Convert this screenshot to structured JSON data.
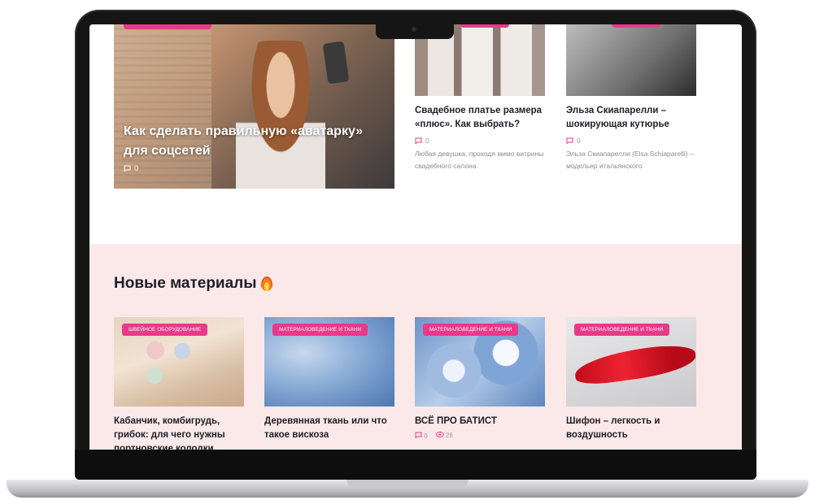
{
  "hero": {
    "title": "Как сделать правильную «аватарку» для соцсетей",
    "comments": "0"
  },
  "featured": [
    {
      "title": "Свадебное платье размера «плюс». Как выбрать?",
      "comments": "0",
      "excerpt": "Любая девушка, проходя мимо витрины свадебного салона"
    },
    {
      "title": "Эльза Скиапарелли – шокирующая кутюрье",
      "comments": "0",
      "excerpt": "Эльза Скиапарелли (Elsa Schiaparelli) – модельер итальянского"
    }
  ],
  "new_materials": {
    "heading": "Новые материалы",
    "cards": [
      {
        "tag": "ШВЕЙНОЕ ОБОРУДОВАНИЕ",
        "title": "Кабанчик, комбигрудь, грибок: для чего нужны портновские колодки"
      },
      {
        "tag": "МАТЕРИАЛОВЕДЕНИЕ И ТКАНИ",
        "title": "Деревянная ткань или что такое вискоза"
      },
      {
        "tag": "МАТЕРИАЛОВЕДЕНИЕ И ТКАНИ",
        "title": "ВСЁ ПРО БАТИСТ",
        "comments": "0",
        "views": "26"
      },
      {
        "tag": "МАТЕРИАЛОВЕДЕНИЕ И ТКАНИ",
        "title": "Шифон – легкость и воздушность"
      }
    ]
  },
  "colors": {
    "accent": "#e8398a",
    "section_bg": "#fbe9e9"
  },
  "icons": {
    "comment": "comment-icon",
    "views": "eye-icon",
    "fire": "fire-icon"
  }
}
